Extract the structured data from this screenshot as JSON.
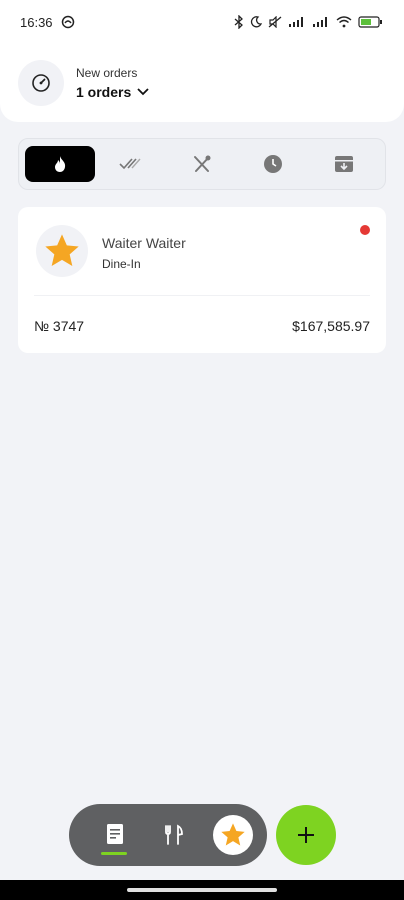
{
  "status_bar": {
    "time": "16:36",
    "icons": [
      "android-debug-icon",
      "bluetooth-icon",
      "moon-icon",
      "mute-icon",
      "signal-icon",
      "signal-icon",
      "wifi-icon",
      "battery-icon"
    ]
  },
  "header": {
    "icon": "dashboard-gauge-icon",
    "label": "New orders",
    "value": "1 orders"
  },
  "tabs": [
    {
      "icon": "fire-icon",
      "active": true
    },
    {
      "icon": "double-check-icon",
      "active": false
    },
    {
      "icon": "fork-knife-icon",
      "active": false
    },
    {
      "icon": "clock-icon",
      "active": false
    },
    {
      "icon": "archive-icon",
      "active": false
    }
  ],
  "order": {
    "avatar_icon": "star-icon",
    "waiter_name": "Waiter Waiter",
    "type": "Dine-In",
    "number": "№ 3747",
    "amount": "$167,585.97",
    "status_color": "#e53935"
  },
  "bottom_nav": {
    "items": [
      "receipt-icon",
      "cutlery-icon",
      "star-icon"
    ],
    "accent": "#7ed321"
  },
  "fab": {
    "icon": "plus-icon",
    "label": "+"
  }
}
